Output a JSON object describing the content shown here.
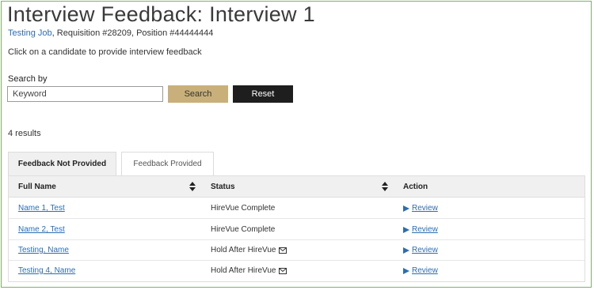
{
  "page": {
    "title": "Interview Feedback: Interview 1",
    "job_link": "Testing Job",
    "requisition_text": ", Requisition #28209, Position #44444444",
    "instruction": "Click on a candidate to provide interview feedback"
  },
  "search": {
    "label": "Search by",
    "placeholder": "Keyword",
    "search_button": "Search",
    "reset_button": "Reset"
  },
  "results": {
    "count_text": "4 results"
  },
  "tabs": [
    {
      "label": "Feedback Not Provided",
      "active": true
    },
    {
      "label": "Feedback Provided",
      "active": false
    }
  ],
  "table": {
    "columns": [
      "Full Name",
      "Status",
      "Action"
    ],
    "rows": [
      {
        "name": "Name 1, Test",
        "status": "HireVue Complete",
        "mail_icon": false,
        "action": "Review"
      },
      {
        "name": "Name 2, Test",
        "status": "HireVue Complete",
        "mail_icon": false,
        "action": "Review"
      },
      {
        "name": "Testing, Name",
        "status": "Hold After HireVue",
        "mail_icon": true,
        "action": "Review"
      },
      {
        "name": "Testing 4, Name",
        "status": "Hold After HireVue",
        "mail_icon": true,
        "action": "Review"
      }
    ]
  },
  "icons": {
    "sort": "sort-icon",
    "review": "play-icon",
    "mail": "mail-icon"
  },
  "colors": {
    "link": "#2a6db5",
    "search_button": "#c9b07a",
    "reset_button": "#1e1e1e",
    "frame_border": "#7fb069"
  }
}
